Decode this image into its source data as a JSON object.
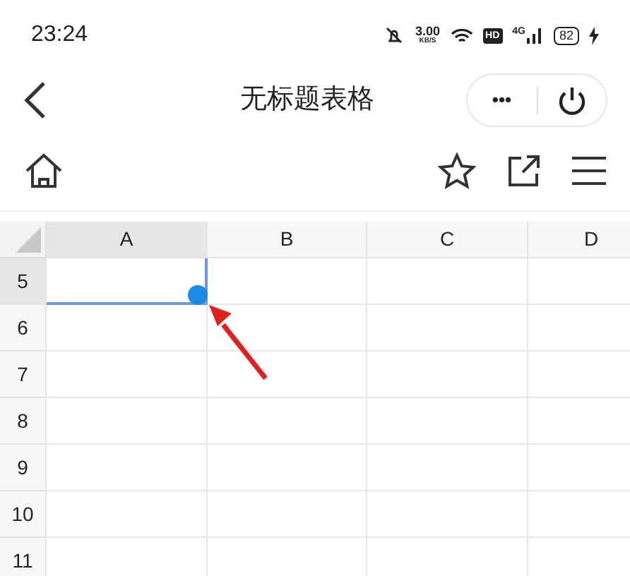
{
  "status_bar": {
    "time": "23:24",
    "speed": "3.00",
    "speed_unit": "KB/S",
    "hd": "HD",
    "network": "4G",
    "battery": "82"
  },
  "nav": {
    "title": "无标题表格",
    "more": "•••"
  },
  "columns": [
    {
      "label": "A",
      "selected": true
    },
    {
      "label": "B",
      "selected": false
    },
    {
      "label": "C",
      "selected": false
    },
    {
      "label": "D",
      "selected": false
    }
  ],
  "rows": [
    {
      "label": "5",
      "selected": true
    },
    {
      "label": "6",
      "selected": false
    },
    {
      "label": "7",
      "selected": false
    },
    {
      "label": "8",
      "selected": false
    },
    {
      "label": "9",
      "selected": false
    },
    {
      "label": "10",
      "selected": false
    },
    {
      "label": "11",
      "selected": false
    }
  ]
}
